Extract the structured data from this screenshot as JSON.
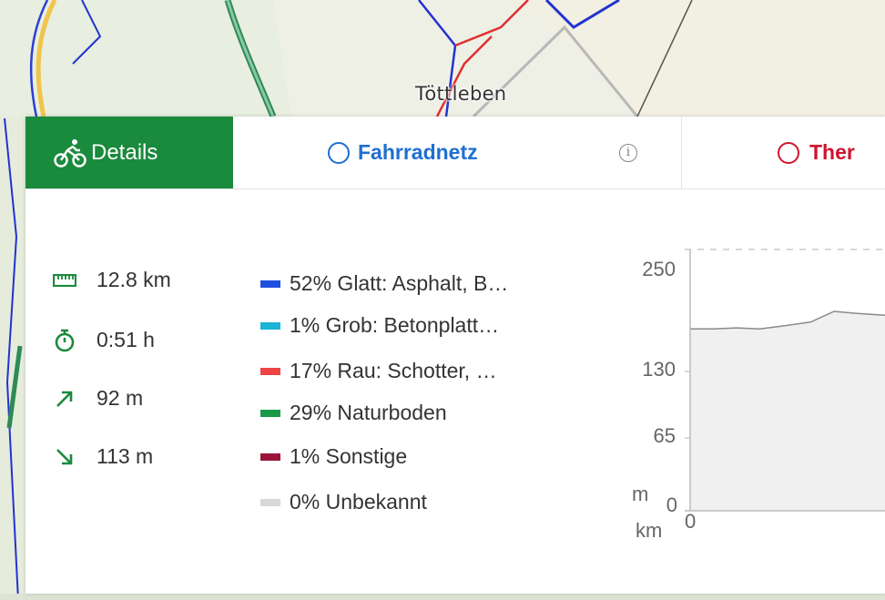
{
  "map": {
    "place_label": "Töttleben"
  },
  "tabs": [
    {
      "label": "Details",
      "icon": "bicycle-icon",
      "active": true,
      "color": "#1a8a3c"
    },
    {
      "label": "Fahrradnetz",
      "icon": "circle-outline-icon",
      "color": "#1f6fd1"
    },
    {
      "label": "Ther",
      "icon": "circle-outline-icon",
      "color": "#d0142e"
    }
  ],
  "info_icon": "i",
  "stats": [
    {
      "icon": "ruler-icon",
      "value": "12.8 km"
    },
    {
      "icon": "stopwatch-icon",
      "value": "0:51 h"
    },
    {
      "icon": "ascent-arrow-icon",
      "value": "92 m"
    },
    {
      "icon": "descent-arrow-icon",
      "value": "113 m"
    }
  ],
  "surface_legend": [
    {
      "label": "52% Glatt: Asphalt, B…",
      "color": "#1f4fe0"
    },
    {
      "label": " 1% Grob: Betonplatt…",
      "color": "#1ab4d4"
    },
    {
      "label": "17% Rau: Schotter, …",
      "color": "#ee4444"
    },
    {
      "label": "29% Naturboden",
      "color": "#1a9a46"
    },
    {
      "label": " 1% Sonstige",
      "color": "#99153a"
    },
    {
      "label": " 0% Unbekannt",
      "color": "#d6d8dc"
    }
  ],
  "chart_data": {
    "type": "area",
    "y_unit": "m",
    "x_unit": "km",
    "y_ticks": [
      "250",
      "130",
      "65",
      "0"
    ],
    "x_ticks": [
      "0"
    ],
    "ylim": [
      0,
      270
    ],
    "x": [
      0,
      0.5,
      1.0,
      1.5,
      2.0,
      2.6,
      3.1,
      3.6,
      4.2
    ],
    "y": [
      188,
      188,
      189,
      188,
      191,
      195,
      206,
      204,
      202
    ]
  }
}
